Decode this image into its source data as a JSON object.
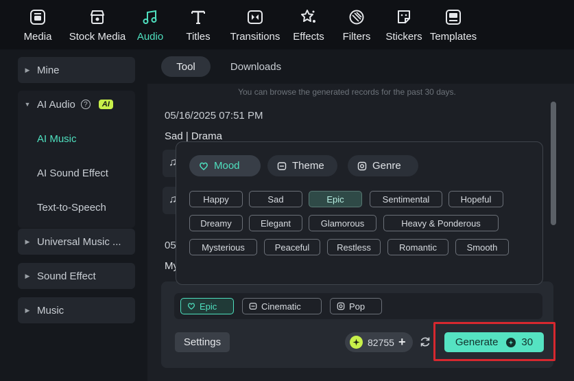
{
  "toolbar": {
    "items": [
      {
        "label": "Media",
        "icon": "media-icon"
      },
      {
        "label": "Stock Media",
        "icon": "stock-media-icon"
      },
      {
        "label": "Audio",
        "icon": "audio-icon",
        "active": true
      },
      {
        "label": "Titles",
        "icon": "titles-icon"
      },
      {
        "label": "Transitions",
        "icon": "transitions-icon"
      },
      {
        "label": "Effects",
        "icon": "effects-icon"
      },
      {
        "label": "Filters",
        "icon": "filters-icon"
      },
      {
        "label": "Stickers",
        "icon": "stickers-icon"
      },
      {
        "label": "Templates",
        "icon": "templates-icon"
      }
    ]
  },
  "sidebar": {
    "mine": "Mine",
    "ai_audio": "AI Audio",
    "ai_badge": "AI",
    "ai_music": "AI Music",
    "ai_sound_effect": "AI Sound Effect",
    "text_to_speech": "Text-to-Speech",
    "universal_music": "Universal Music ...",
    "sound_effect": "Sound Effect",
    "music": "Music"
  },
  "tabs": {
    "tool": "Tool",
    "downloads": "Downloads"
  },
  "hint": "You can browse the generated records for the past 30 days.",
  "records": [
    {
      "date": "05/16/2025 07:51 PM",
      "tags": "Sad | Drama"
    },
    {
      "date": "05",
      "tags": "My"
    }
  ],
  "popup": {
    "categories": [
      {
        "label": "Mood",
        "icon": "mood-icon",
        "active": true
      },
      {
        "label": "Theme",
        "icon": "theme-icon"
      },
      {
        "label": "Genre",
        "icon": "genre-icon"
      }
    ],
    "moods": [
      "Happy",
      "Sad",
      "Epic",
      "Sentimental",
      "Hopeful",
      "Dreamy",
      "Elegant",
      "Glamorous",
      "Heavy & Ponderous",
      "Mysterious",
      "Peaceful",
      "Restless",
      "Romantic",
      "Smooth"
    ],
    "selected_mood": "Epic"
  },
  "prompt": {
    "selected_tags": [
      {
        "label": "Epic",
        "icon": "mood-icon"
      },
      {
        "label": "Cinematic",
        "icon": "theme-icon"
      },
      {
        "label": "Pop",
        "icon": "genre-icon"
      }
    ],
    "settings_label": "Settings",
    "credits": "82755",
    "generate_label": "Generate",
    "generate_cost": "30"
  },
  "colors": {
    "accent": "#4fe0bf",
    "generate_bg": "#55e3c2",
    "ai_badge": "#c8f04a",
    "highlight": "#d7282f"
  }
}
